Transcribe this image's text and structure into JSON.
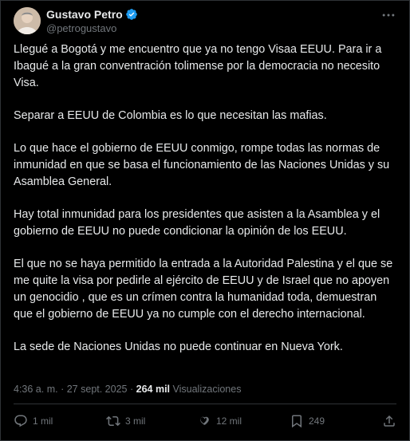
{
  "author": {
    "display_name": "Gustavo Petro",
    "handle": "@petrogustavo",
    "verified": true
  },
  "tweet": {
    "paragraphs": [
      "Llegué a Bogotá y me encuentro que ya no tengo Visaa EEUU. Para ir a Ibagué a la gran conventración tolimense por la democracia no necesito Visa.",
      "Separar a EEUU de Colombia es lo que necesitan las mafias.",
      "Lo que hace el gobierno de EEUU conmigo, rompe todas las normas de inmunidad en que se basa el funcionamiento de las Naciones Unidas y su Asamblea General.",
      "Hay total inmunidad para los presidentes que asisten a la Asamblea y el gobierno de EEUU no puede condicionar la opinión de los EEUU.",
      "El que no se haya permitido la entrada a la Autoridad Palestina y el que se me quite la visa por pedirle al ejército de EEUU y de Israel que no apoyen un genocidio , que es un crímen contra la humanidad toda, demuestran que el gobierno de EEUU ya no cumple con el derecho internacional.",
      "La sede de Naciones Unidas no puede continuar en Nueva York."
    ]
  },
  "meta": {
    "time": "4:36 a. m.",
    "separator": "·",
    "date": "27 sept. 2025",
    "views_count": "264 mil",
    "views_label": "Visualizaciones"
  },
  "actions": {
    "replies": "1 mil",
    "reposts": "3 mil",
    "likes": "12 mil",
    "bookmarks": "249"
  },
  "colors": {
    "background": "#000000",
    "text": "#e7e9ea",
    "muted": "#71767b",
    "verified": "#1d9bf0",
    "border": "#2f3336"
  },
  "icons": [
    "verified-badge-icon",
    "more-icon",
    "reply-icon",
    "repost-icon",
    "like-icon",
    "bookmark-icon",
    "share-icon"
  ]
}
